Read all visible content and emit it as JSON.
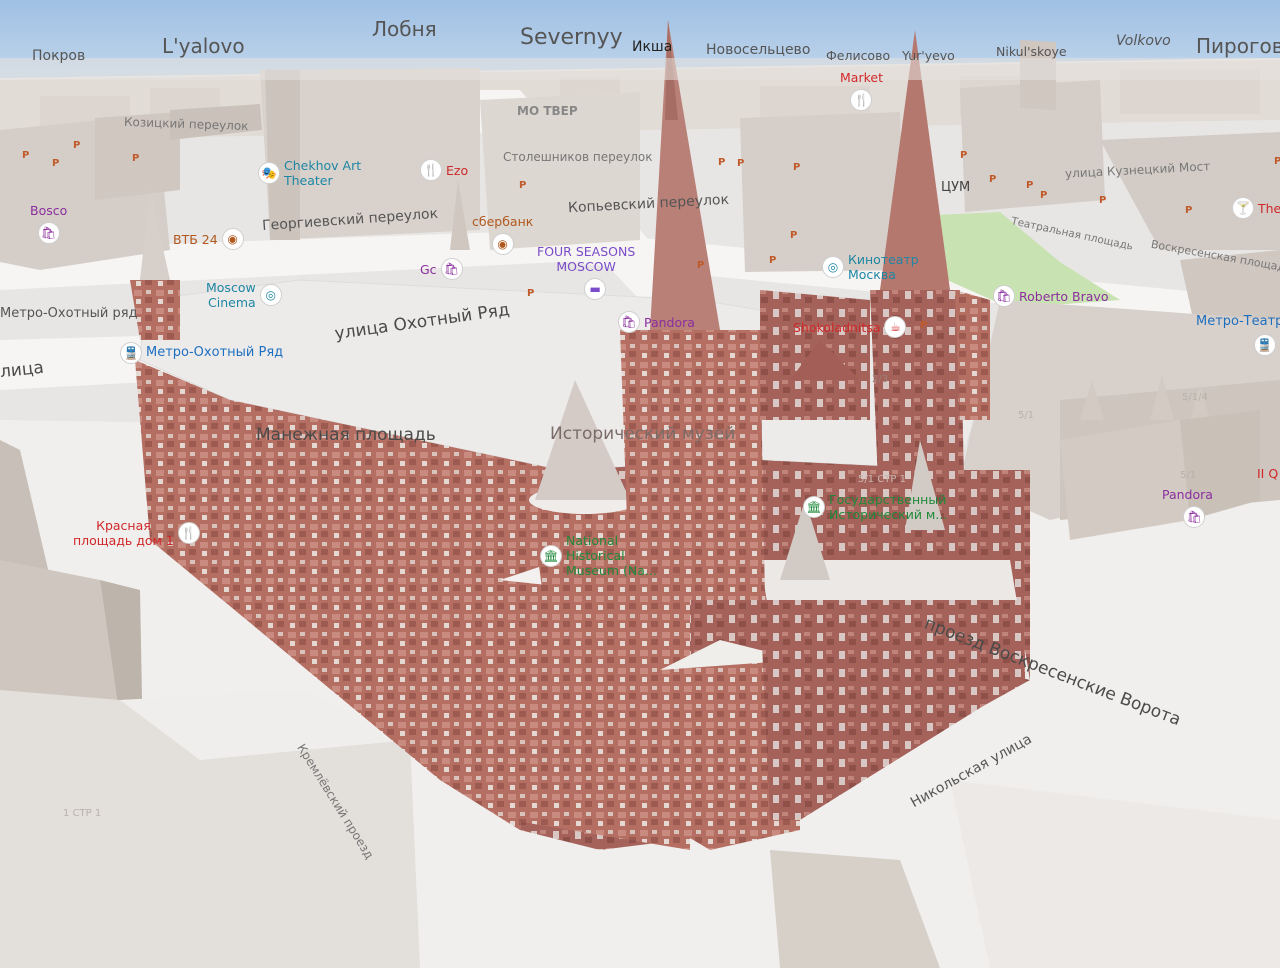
{
  "colors": {
    "sky": "#a9c6e6",
    "ground": "#e8e6e4",
    "building": "#d8d1cb",
    "brick": "#b56e62",
    "park": "#c9e2b2",
    "shop": "#8b2e9e",
    "food": "#d0282a",
    "entertainment": "#1e86a3",
    "bank": "#b0581e",
    "museum": "#1f8a3a",
    "transit": "#1f6fc0"
  },
  "cities": [
    {
      "name": "Покров"
    },
    {
      "name": "L'yalovo"
    },
    {
      "name": "Лобня"
    },
    {
      "name": "Severnyy"
    },
    {
      "name": "Икша"
    },
    {
      "name": "Новосельцево"
    },
    {
      "name": "Фелисово"
    },
    {
      "name": "Yur'yevo"
    },
    {
      "name": "Nikul'skoye"
    },
    {
      "name": "Volkovo"
    },
    {
      "name": "Пирогово"
    }
  ],
  "streets": [
    {
      "name": "Козицкий переулок"
    },
    {
      "name": "Столешников переулок"
    },
    {
      "name": "улица Кузнецкий Мост"
    },
    {
      "name": "Георгиевский переулок"
    },
    {
      "name": "Копьевский переулок"
    },
    {
      "name": "Театральная площадь"
    },
    {
      "name": "Воскресенская площадь"
    },
    {
      "name": "улица Охотный Ряд"
    },
    {
      "name": "Метро-Охотный ряд"
    },
    {
      "name": "лица"
    },
    {
      "name": "Манежная площадь"
    },
    {
      "name": "Исторический музей"
    },
    {
      "name": "проезд Воскресенские Ворота"
    },
    {
      "name": "Никольская улица"
    },
    {
      "name": "Кремлёвский проезд"
    },
    {
      "name": "МО ТВЕР"
    },
    {
      "name": "ЦУМ"
    }
  ],
  "pois": [
    {
      "label": "Bosco",
      "icon": "shopping-bag-icon",
      "glyph": "🛍",
      "type": "shop"
    },
    {
      "label": "Chekhov Art\nTheater",
      "icon": "theater-icon",
      "glyph": "🎭",
      "type": "ent"
    },
    {
      "label": "Ezo",
      "icon": "restaurant-icon",
      "glyph": "🍴",
      "type": "food"
    },
    {
      "label": "Market",
      "icon": "restaurant-icon",
      "glyph": "🍴",
      "type": "food"
    },
    {
      "label": "ВТБ 24",
      "icon": "bank-icon",
      "glyph": "◉",
      "type": "bank"
    },
    {
      "label": "сбербанк",
      "icon": "bank-icon",
      "glyph": "◉",
      "type": "bank"
    },
    {
      "label": "Gc",
      "icon": "shopping-bag-icon",
      "glyph": "🛍",
      "type": "shop"
    },
    {
      "label": "FOUR SEASONS\nMOSCOW",
      "icon": "hotel-icon",
      "glyph": "▬",
      "type": "hotel"
    },
    {
      "label": "Moscow\nCinema",
      "icon": "cinema-icon",
      "glyph": "◎",
      "type": "ent"
    },
    {
      "label": "Кинотеатр\nМосква",
      "icon": "cinema-icon",
      "glyph": "◎",
      "type": "ent"
    },
    {
      "label": "Roberto Bravo",
      "icon": "shopping-bag-icon",
      "glyph": "🛍",
      "type": "shop"
    },
    {
      "label": "The",
      "icon": "cocktail-icon",
      "glyph": "🍸",
      "type": "food"
    },
    {
      "label": "Метро-Театр",
      "icon": "metro-icon",
      "glyph": "🚆",
      "type": "transit"
    },
    {
      "label": "Метро-Охотный Ряд",
      "icon": "metro-icon",
      "glyph": "🚆",
      "type": "transit"
    },
    {
      "label": "Pandora",
      "icon": "shopping-bag-icon",
      "glyph": "🛍",
      "type": "shop"
    },
    {
      "label": "Shokoladnitsa",
      "icon": "coffee-icon",
      "glyph": "☕",
      "type": "food"
    },
    {
      "label": "Государственный\nИсторический м...",
      "icon": "museum-icon",
      "glyph": "🏛",
      "type": "museum"
    },
    {
      "label": "National\nHistorical\nMuseum (Na...",
      "icon": "museum-icon",
      "glyph": "🏛",
      "type": "museum"
    },
    {
      "label": "Pandora",
      "icon": "shopping-bag-icon",
      "glyph": "🛍",
      "type": "shop"
    },
    {
      "label": "Красная\nплощадь дом 1",
      "icon": "restaurant-icon",
      "glyph": "🍴",
      "type": "food"
    },
    {
      "label": "II Q",
      "icon": "",
      "glyph": "",
      "type": "food"
    }
  ],
  "parking": {
    "symbol": "P"
  },
  "numbers": [
    "2/3",
    "5/1 СТР 1",
    "5/1",
    "1 СТР 1",
    "5/1/4",
    "5/1"
  ]
}
